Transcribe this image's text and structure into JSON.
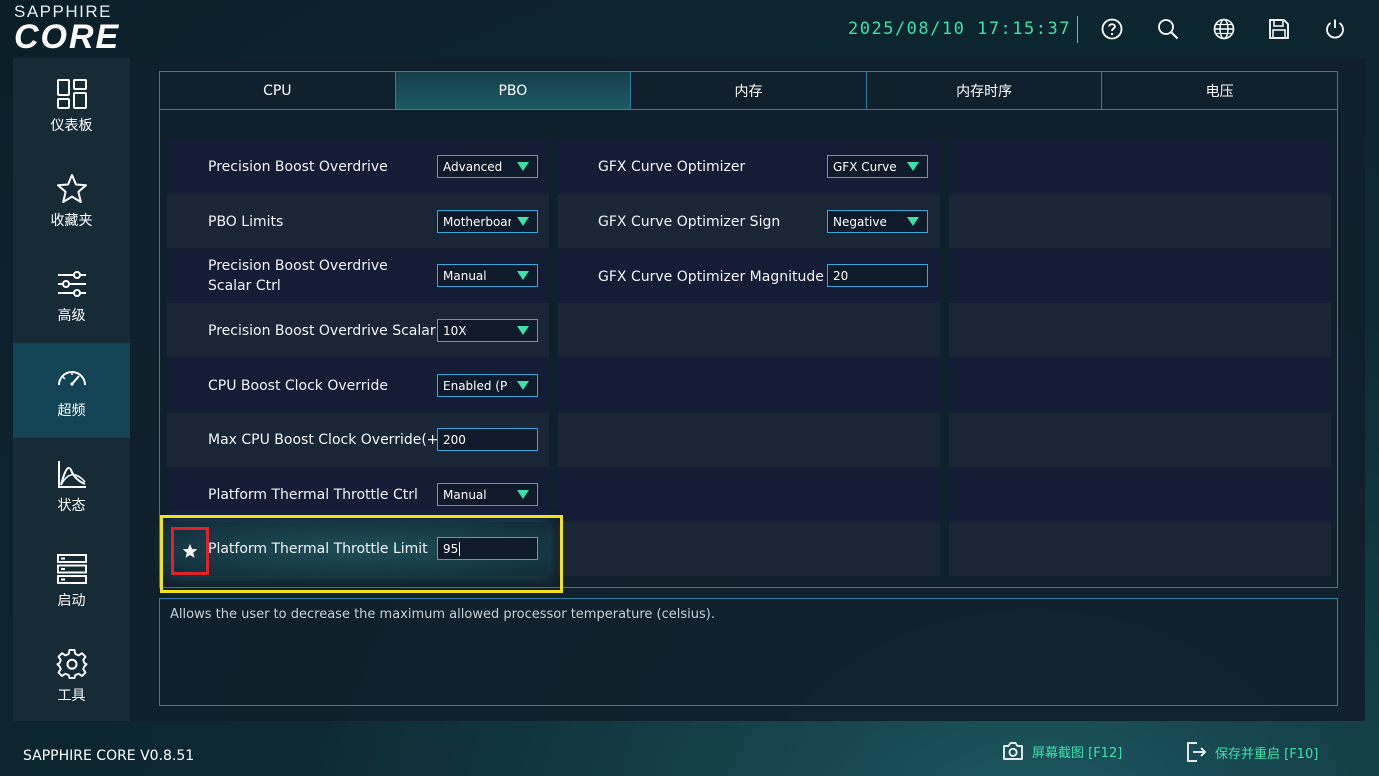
{
  "header": {
    "brand_top": "SAPPHIRE",
    "brand_main": "CORE",
    "datetime": "2025/08/10 17:15:37",
    "icons": [
      "help-icon",
      "search-icon",
      "globe-icon",
      "save-icon",
      "power-icon"
    ]
  },
  "sidebar": {
    "items": [
      {
        "label": "仪表板",
        "icon": "dashboard-icon"
      },
      {
        "label": "收藏夹",
        "icon": "star-icon"
      },
      {
        "label": "高级",
        "icon": "sliders-icon"
      },
      {
        "label": "超频",
        "icon": "gauge-icon",
        "active": true
      },
      {
        "label": "状态",
        "icon": "chart-icon"
      },
      {
        "label": "启动",
        "icon": "server-icon"
      },
      {
        "label": "工具",
        "icon": "gear-icon"
      }
    ]
  },
  "tabs": [
    {
      "label": "CPU"
    },
    {
      "label": "PBO",
      "active": true
    },
    {
      "label": "内存"
    },
    {
      "label": "内存时序"
    },
    {
      "label": "电压"
    }
  ],
  "settings_left": [
    {
      "label": "Precision Boost Overdrive",
      "type": "select",
      "value": "Advanced"
    },
    {
      "label": "PBO Limits",
      "type": "select",
      "value": "Motherboar"
    },
    {
      "label": "Precision Boost Overdrive Scalar Ctrl",
      "type": "select",
      "value": "Manual"
    },
    {
      "label": "Precision Boost Overdrive Scalar",
      "type": "select",
      "value": "10X"
    },
    {
      "label": "CPU Boost Clock Override",
      "type": "select",
      "value": "Enabled (P"
    },
    {
      "label": "Max CPU Boost Clock Override(+)",
      "type": "input",
      "value": "200"
    },
    {
      "label": "Platform Thermal Throttle Ctrl",
      "type": "select",
      "value": "Manual"
    },
    {
      "label": "Platform Thermal Throttle Limit",
      "type": "input",
      "value": "95",
      "selected": true,
      "favorite": true
    }
  ],
  "settings_middle": [
    {
      "label": "GFX Curve Optimizer",
      "type": "select",
      "value": "GFX Curve"
    },
    {
      "label": "GFX Curve Optimizer Sign",
      "type": "select",
      "value": "Negative"
    },
    {
      "label": "GFX Curve Optimizer Magnitude",
      "type": "input",
      "value": "20"
    }
  ],
  "description": "Allows the user to decrease the maximum allowed processor temperature (celsius).",
  "footer": {
    "version": "SAPPHIRE CORE V0.8.51",
    "screenshot_label": "屏幕截图 [F12]",
    "save_restart_label": "保存并重启 [F10]"
  },
  "colors": {
    "accent": "#3fe0a8",
    "border": "#2e7fa4",
    "highlight_yellow": "#f2e21a",
    "highlight_red": "#e0202a"
  }
}
